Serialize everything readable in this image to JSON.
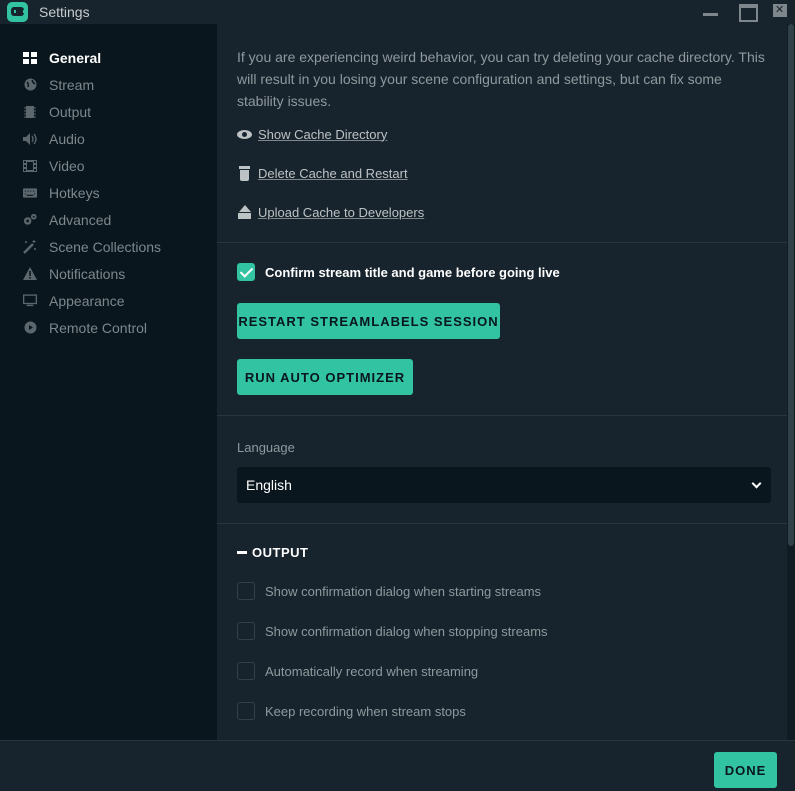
{
  "window": {
    "title": "Settings"
  },
  "sidebar": {
    "items": [
      {
        "label": "General",
        "icon": "grid-icon",
        "active": true
      },
      {
        "label": "Stream",
        "icon": "globe-icon",
        "active": false
      },
      {
        "label": "Output",
        "icon": "chip-icon",
        "active": false
      },
      {
        "label": "Audio",
        "icon": "speaker-icon",
        "active": false
      },
      {
        "label": "Video",
        "icon": "film-icon",
        "active": false
      },
      {
        "label": "Hotkeys",
        "icon": "keyboard-icon",
        "active": false
      },
      {
        "label": "Advanced",
        "icon": "gears-icon",
        "active": false
      },
      {
        "label": "Scene Collections",
        "icon": "wand-icon",
        "active": false
      },
      {
        "label": "Notifications",
        "icon": "warning-icon",
        "active": false
      },
      {
        "label": "Appearance",
        "icon": "monitor-icon",
        "active": false
      },
      {
        "label": "Remote Control",
        "icon": "play-circle-icon",
        "active": false
      }
    ]
  },
  "cache": {
    "description": "If you are experiencing weird behavior, you can try deleting your cache directory. This will result in you losing your scene configuration and settings, but can fix some stability issues.",
    "show_label": "Show Cache Directory",
    "delete_label": "Delete Cache and Restart",
    "upload_label": "Upload Cache to Developers"
  },
  "general": {
    "confirm_label": "Confirm stream title and game before going live",
    "confirm_checked": true,
    "restart_label": "RESTART STREAMLABELS SESSION",
    "optimizer_label": "RUN AUTO OPTIMIZER"
  },
  "language": {
    "label": "Language",
    "value": "English"
  },
  "output": {
    "heading": "OUTPUT",
    "options": [
      {
        "label": "Show confirmation dialog when starting streams",
        "checked": false
      },
      {
        "label": "Show confirmation dialog when stopping streams",
        "checked": false
      },
      {
        "label": "Automatically record when streaming",
        "checked": false
      },
      {
        "label": "Keep recording when stream stops",
        "checked": false
      }
    ]
  },
  "footer": {
    "done_label": "DONE"
  },
  "colors": {
    "accent": "#31c3a2",
    "panel": "#17242d",
    "sidebar": "#09161d"
  }
}
